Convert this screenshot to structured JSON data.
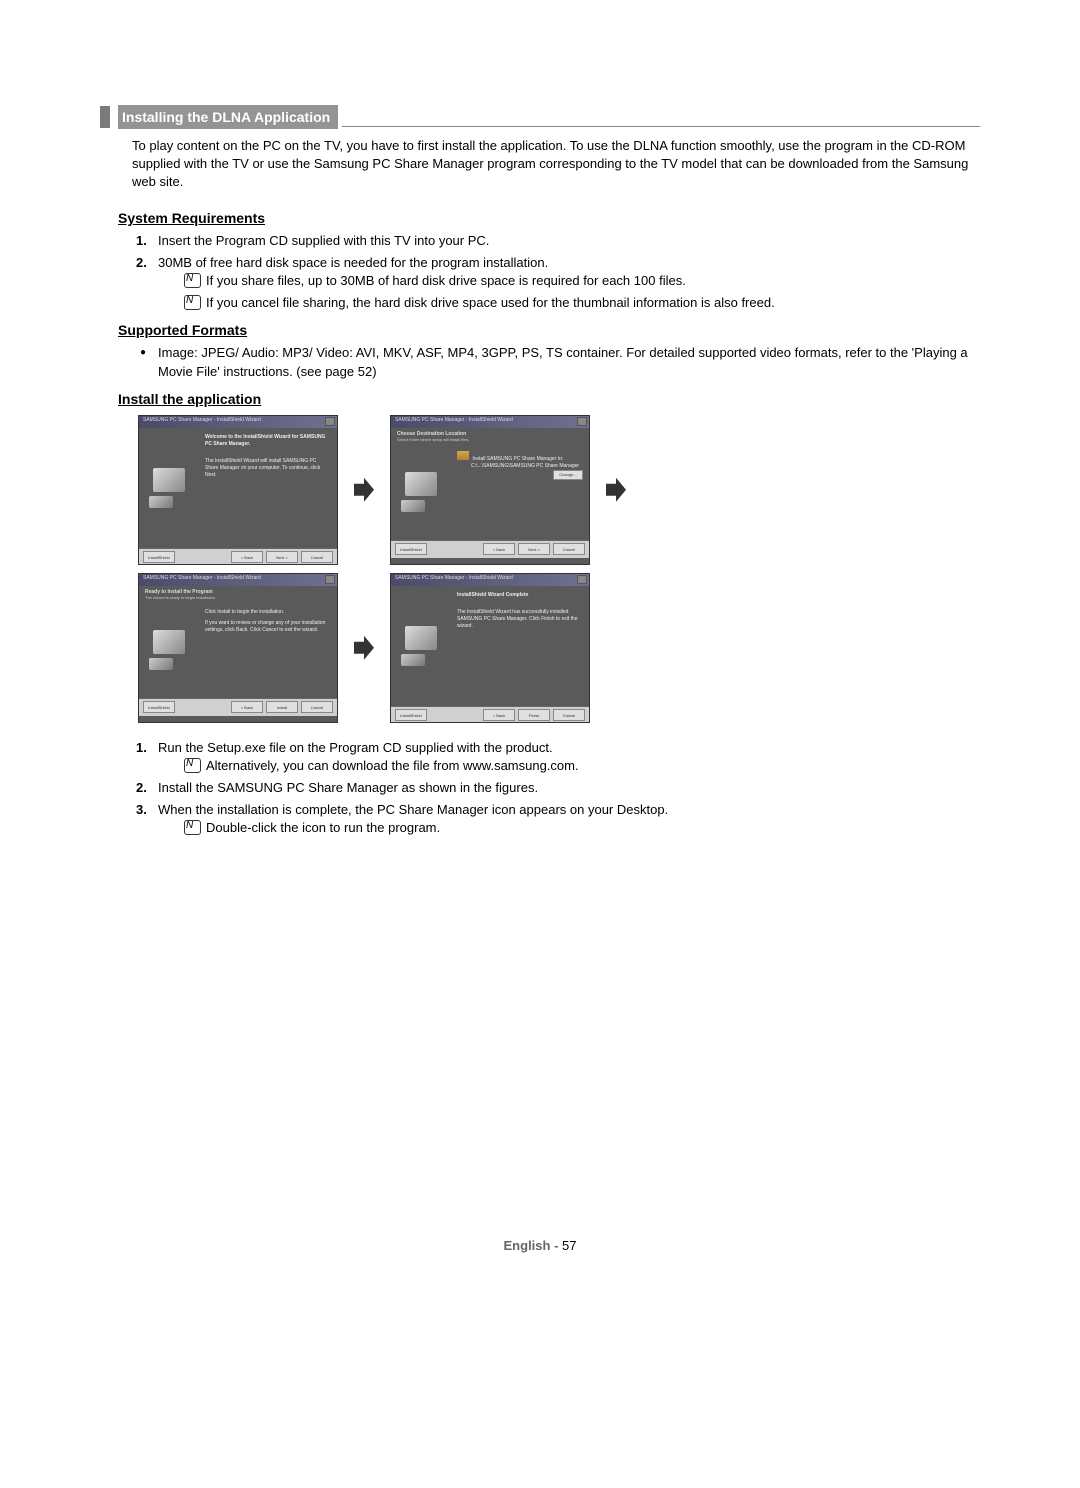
{
  "section": {
    "title": "Installing the DLNA Application",
    "intro": "To play content on the PC on the TV, you have to first install the application. To use the DLNA function smoothly, use the program in the CD-ROM supplied with the TV or use the Samsung PC Share Manager program corresponding to the TV model that can be downloaded from the Samsung web site."
  },
  "sysreq": {
    "header": "System Requirements",
    "items": [
      "Insert the Program CD supplied with this TV into your PC.",
      "30MB of free hard disk space is needed for the program  installation."
    ],
    "notes": [
      "If you share files, up to 30MB of hard disk drive space is required for each 100 files.",
      "If you cancel file sharing, the hard disk drive space used for the thumbnail information is also freed."
    ]
  },
  "formats": {
    "header": "Supported Formats",
    "item": "Image: JPEG/ Audio: MP3/ Video: AVI, MKV, ASF, MP4, 3GPP, PS, TS container. For detailed supported video formats, refer to the 'Playing a Movie File' instructions. (see page 52)"
  },
  "install": {
    "header": "Install the application",
    "titlebar": "SAMSUNG PC Share Manager - InstallShield Wizard",
    "step1_line1": "Welcome to the InstallShield Wizard for SAMSUNG PC Share Manager.",
    "step1_line2": "The InstallShield Wizard will install SAMSUNG PC Share Manager on your computer. To continue, click Next.",
    "step2_title": "Choose Destination Location",
    "step2_sub": "Select folder where setup will install files.",
    "step2_text1": "Install SAMSUNG PC Share Manager to:",
    "step2_text2": "C:\\...\\SAMSUNG\\SAMSUNG PC Share Manager",
    "step3_title": "Ready to Install the Program",
    "step3_sub": "The wizard is ready to begin installation.",
    "step3_text": "Click Install to begin the installation.",
    "step3_text2": "If you want to review or change any of your installation settings, click Back. Click Cancel to exit the wizard.",
    "step4_title": "InstallShield Wizard Complete",
    "step4_text": "The InstallShield Wizard has successfully installed SAMSUNG PC Share Manager. Click Finish to exit the wizard.",
    "btn_back": "< Back",
    "btn_next": "Next >",
    "btn_cancel": "Cancel",
    "btn_install": "Install",
    "btn_finish": "Finish",
    "btn_change": "Change...",
    "instructions": [
      "Run the Setup.exe file on the Program CD supplied with the product.",
      "Install the SAMSUNG PC Share Manager as shown in the figures.",
      "When the installation is complete, the PC Share Manager icon appears on your Desktop."
    ],
    "inst_note1": "Alternatively, you can download the file from www.samsung.com.",
    "inst_note2": "Double-click the icon to run the program."
  },
  "footer": {
    "lang": "English - ",
    "page": "57"
  }
}
